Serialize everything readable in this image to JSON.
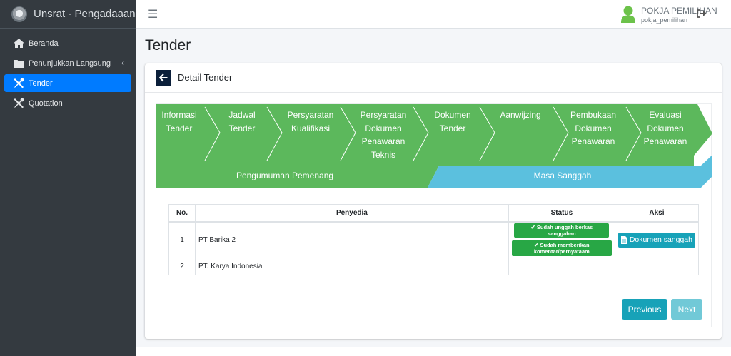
{
  "app": {
    "brand": "Unsrat - Pengadaaan Ba"
  },
  "sidebar": {
    "items": [
      {
        "label": "Beranda",
        "icon": "home-icon"
      },
      {
        "label": "Penunjukkan Langsung",
        "icon": "folder-icon",
        "caret": "‹"
      },
      {
        "label": "Tender",
        "icon": "tools-icon",
        "active": true
      },
      {
        "label": "Quotation",
        "icon": "tools-icon"
      }
    ]
  },
  "header": {
    "menu_icon": "☰",
    "user_name": "POKJA PEMILIHAN",
    "user_id": "pokja_pemilihan"
  },
  "page": {
    "title": "Tender"
  },
  "card": {
    "title": "Detail Tender"
  },
  "steps": [
    {
      "lines": [
        "Informasi",
        "Tender"
      ]
    },
    {
      "lines": [
        "Jadwal",
        "Tender"
      ]
    },
    {
      "lines": [
        "Persyaratan",
        "Kualifikasi"
      ]
    },
    {
      "lines": [
        "Persyaratan",
        "Dokumen",
        "Penawaran",
        "Teknis"
      ]
    },
    {
      "lines": [
        "Dokumen",
        "Tender"
      ]
    },
    {
      "lines": [
        "Aanwijzing"
      ]
    },
    {
      "lines": [
        "Pembukaan",
        "Dokumen",
        "Penawaran"
      ]
    },
    {
      "lines": [
        "Evaluasi",
        "Dokumen",
        "Penawaran"
      ]
    }
  ],
  "stage_bar": {
    "left": "Pengumuman Pemenang",
    "right": "Masa Sanggah"
  },
  "colors": {
    "green": "#5cb85c",
    "blue": "#5bc0de",
    "primary": "#007bff",
    "info": "#17a2b8",
    "sidebar": "#343a40"
  },
  "table": {
    "headers": {
      "no": "No.",
      "penyedia": "Penyedia",
      "status": "Status",
      "aksi": "Aksi"
    },
    "rows": [
      {
        "no": "1",
        "penyedia": "PT Barika 2",
        "status": [
          "Sudah unggah berkas sanggahan",
          "Sudah memberikan komentar/pernyataam"
        ],
        "aksi": "Dokumen sanggah"
      },
      {
        "no": "2",
        "penyedia": "PT. Karya Indonesia"
      }
    ]
  },
  "pager": {
    "prev": "Previous",
    "next": "Next"
  }
}
